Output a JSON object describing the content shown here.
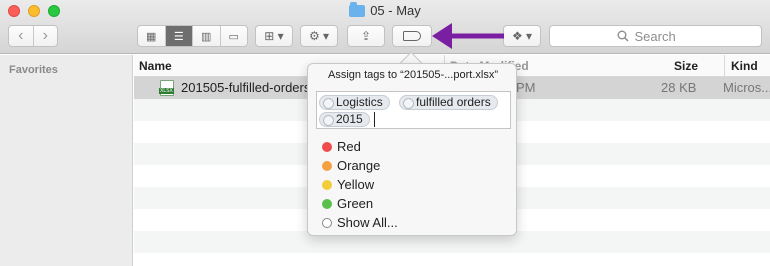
{
  "window": {
    "title": "05 - May"
  },
  "toolbar": {
    "nav_back": "‹",
    "nav_forward": "›",
    "views": [
      "▦",
      "☰",
      "▥",
      "▭"
    ],
    "arrange_label": "⊞ ▾",
    "action_label": "⚙ ▾",
    "share_label": "⇪",
    "dropbox_label": "❖ ▾",
    "search_placeholder": "Search"
  },
  "sidebar": {
    "heading": "Favorites"
  },
  "columns": {
    "name": "Name",
    "date": "Date Modified",
    "size": "Size",
    "kind": "Kind"
  },
  "file": {
    "name": "201505-fulfilled-orders-report.xlsx",
    "date_fragment": "PM",
    "size": "28 KB",
    "kind": "Micros..."
  },
  "popover": {
    "title": "Assign tags to “201505-...port.xlsx”",
    "tags": [
      "Logistics",
      "fulfilled orders",
      "2015"
    ],
    "colors": [
      {
        "label": "Red",
        "color": "#f04b4b"
      },
      {
        "label": "Orange",
        "color": "#f5a142"
      },
      {
        "label": "Yellow",
        "color": "#f2cd3a"
      },
      {
        "label": "Green",
        "color": "#5ac04c"
      },
      {
        "label": "Show All...",
        "color": ""
      }
    ]
  },
  "annotation": {
    "arrow_color": "#7b1fa2"
  }
}
